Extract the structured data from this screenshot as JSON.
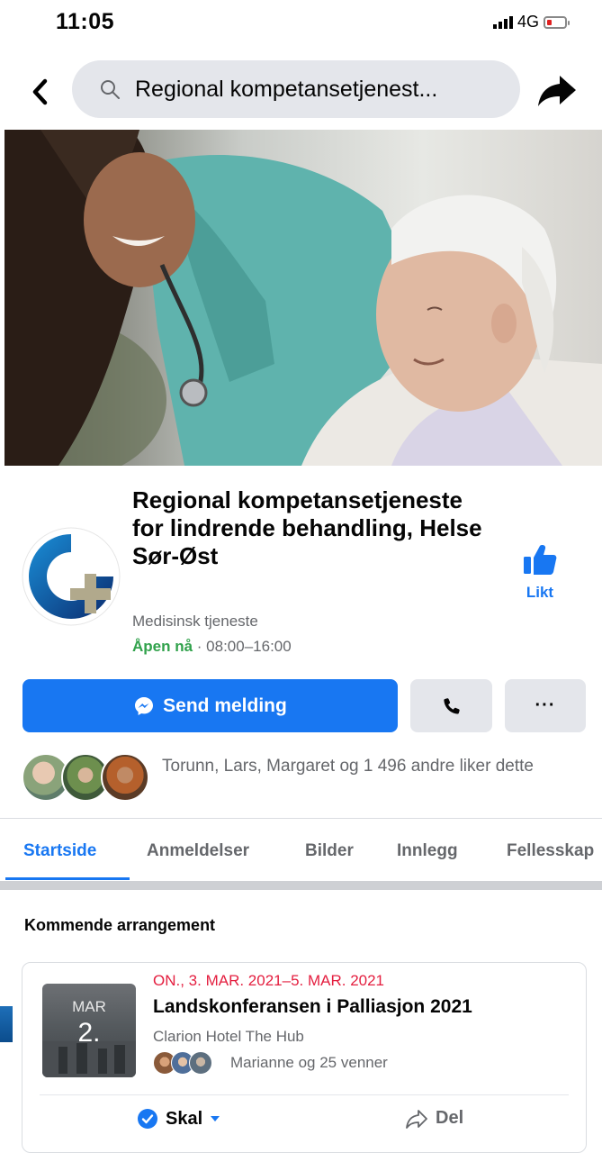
{
  "status_bar": {
    "time": "11:05",
    "network": "4G"
  },
  "search": {
    "text": "Regional kompetansetjenest..."
  },
  "page": {
    "name": "Regional kompetansetjeneste for lindrende behandling, Helse Sør-Øst",
    "category": "Medisinsk tjeneste",
    "open_status": "Åpen nå",
    "hours": " · 08:00–16:00",
    "like_label": "Likt"
  },
  "actions": {
    "send_label": "Send melding",
    "more_label": "···"
  },
  "likers": {
    "text": "Torunn, Lars, Margaret og 1 496 andre liker dette"
  },
  "tabs": [
    "Startside",
    "Anmeldelser",
    "Bilder",
    "Innlegg",
    "Fellesskap"
  ],
  "events": {
    "section_title": "Kommende arrangement",
    "items": [
      {
        "date_range": "ON., 3. MAR. 2021–5. MAR. 2021",
        "title": "Landskonferansen i Palliasjon 2021",
        "location": "Clarion Hotel The Hub",
        "friends": "Marianne og 25 venner",
        "thumb_month": "MAR",
        "thumb_day": "2.",
        "going_label": "Skal",
        "share_label": "Del"
      }
    ]
  },
  "colors": {
    "accent": "#1877f2",
    "open": "#31a24c",
    "event_date": "#e41e3f",
    "secondary_text": "#65676b"
  }
}
